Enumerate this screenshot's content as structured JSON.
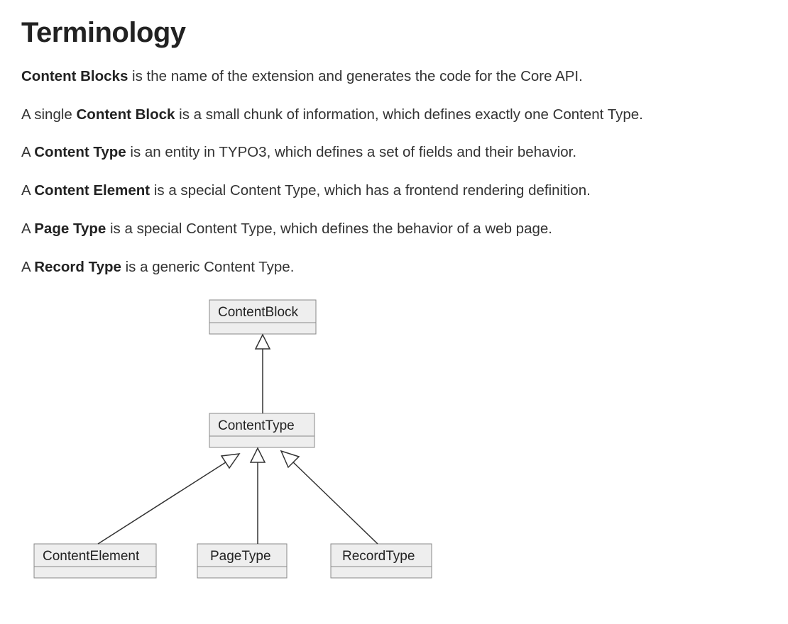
{
  "heading": "Terminology",
  "paragraphs": {
    "p1_bold": "Content Blocks",
    "p1_rest": " is the name of the extension and generates the code for the Core API.",
    "p2_pre": "A single ",
    "p2_bold": "Content Block",
    "p2_rest": " is a small chunk of information, which defines exactly one Content Type.",
    "p3_pre": "A ",
    "p3_bold": "Content Type",
    "p3_rest": " is an entity in TYPO3, which defines a set of fields and their behavior.",
    "p4_pre": "A ",
    "p4_bold": "Content Element",
    "p4_rest": " is a special Content Type, which has a frontend rendering definition.",
    "p5_pre": "A ",
    "p5_bold": "Page Type",
    "p5_rest": " is a special Content Type, which defines the behavior of a web page.",
    "p6_pre": "A ",
    "p6_bold": "Record Type",
    "p6_rest": " is a generic Content Type."
  },
  "diagram": {
    "nodes": {
      "content_block": "ContentBlock",
      "content_type": "ContentType",
      "content_element": "ContentElement",
      "page_type": "PageType",
      "record_type": "RecordType"
    }
  }
}
